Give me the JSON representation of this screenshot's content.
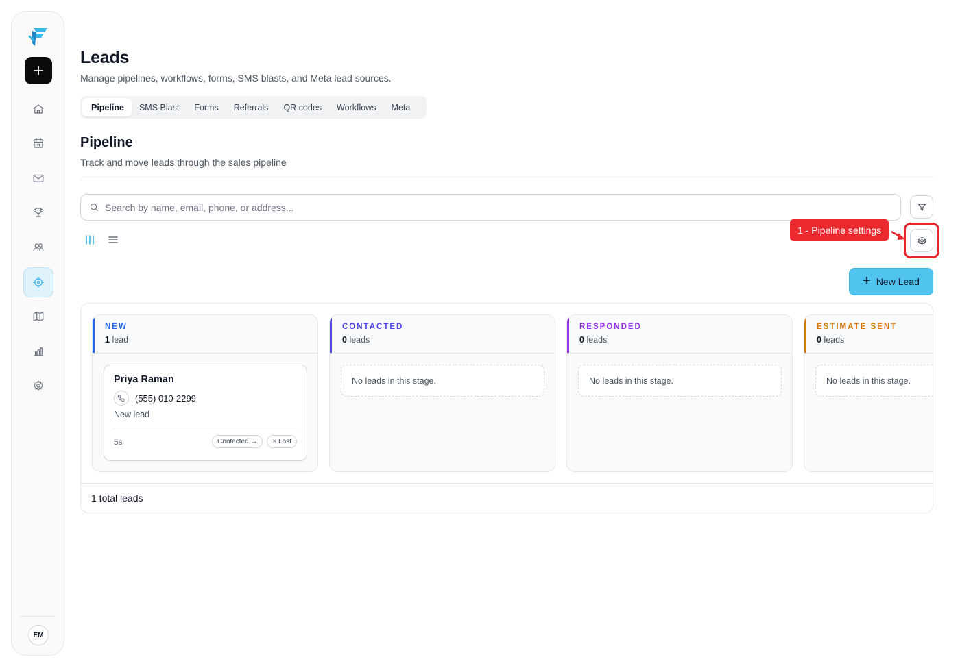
{
  "sidebar": {
    "logo_icon": "brand-logo-icon",
    "add_button_label": "+",
    "items": [
      {
        "icon": "home-icon"
      },
      {
        "icon": "calendar-icon"
      },
      {
        "icon": "mail-icon"
      },
      {
        "icon": "trophy-icon"
      },
      {
        "icon": "users-icon"
      },
      {
        "icon": "crosshair-icon",
        "active": true
      },
      {
        "icon": "map-icon"
      },
      {
        "icon": "bar-chart-icon"
      },
      {
        "icon": "gear-icon"
      }
    ],
    "avatar_initials": "EM",
    "accent_color": "#38b6e8"
  },
  "header": {
    "title": "Leads",
    "subtitle": "Manage pipelines, workflows, forms, SMS blasts, and Meta lead sources."
  },
  "tabs": [
    {
      "label": "Pipeline",
      "active": true
    },
    {
      "label": "SMS Blast"
    },
    {
      "label": "Forms"
    },
    {
      "label": "Referrals"
    },
    {
      "label": "QR codes"
    },
    {
      "label": "Workflows"
    },
    {
      "label": "Meta"
    }
  ],
  "pipeline": {
    "title": "Pipeline",
    "subtitle": "Track and move leads through the sales pipeline",
    "search_placeholder": "Search by name, email, phone, or address...",
    "callout_label": "1 - Pipeline settings",
    "new_lead_label": "New Lead",
    "footer_total": "1 total leads"
  },
  "columns": [
    {
      "title": "NEW",
      "count_number": "1",
      "count_unit": "lead",
      "color": "#2563eb",
      "card": {
        "name": "Priya Raman",
        "phone": "(555) 010-2299",
        "status": "New lead",
        "age": "5s",
        "action_advance": "Contacted →",
        "action_lost": "× Lost"
      }
    },
    {
      "title": "CONTACTED",
      "count_number": "0",
      "count_unit": "leads",
      "color": "#4f46e5",
      "empty_text": "No leads in this stage."
    },
    {
      "title": "RESPONDED",
      "count_number": "0",
      "count_unit": "leads",
      "color": "#9333ea",
      "empty_text": "No leads in this stage."
    },
    {
      "title": "ESTIMATE SENT",
      "count_number": "0",
      "count_unit": "leads",
      "color": "#d97706",
      "empty_text": "No leads in this stage."
    }
  ]
}
